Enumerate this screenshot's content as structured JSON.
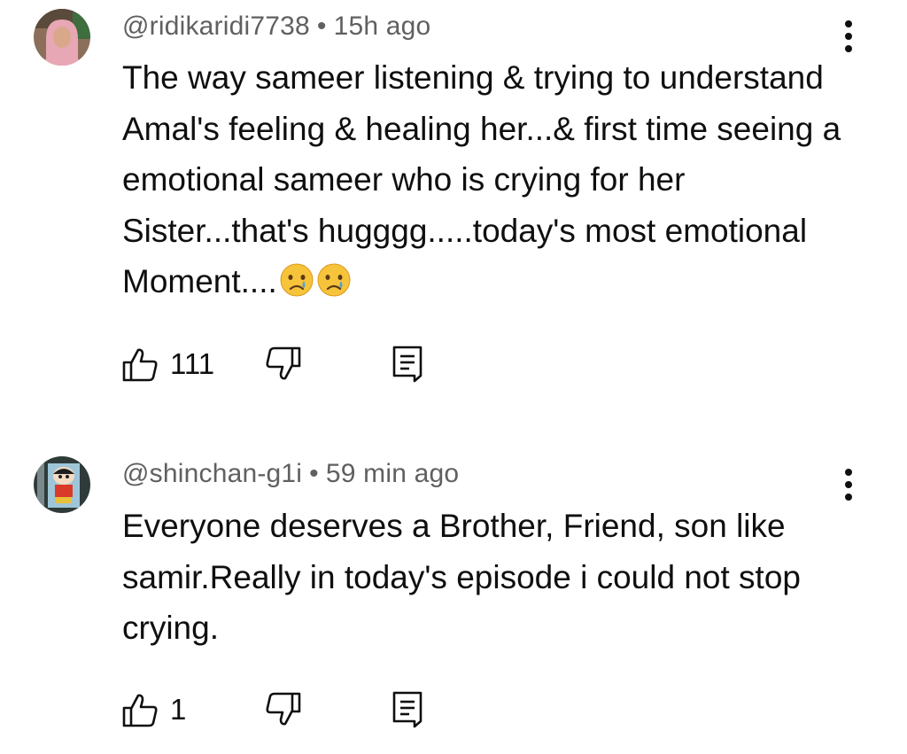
{
  "comments": [
    {
      "handle": "@ridikaridi7738",
      "separator": "•",
      "time": "15h ago",
      "text": "The way sameer listening & trying to understand Amal's feeling & healing her...& first time seeing a emotional sameer who is crying for her Sister...that's hugggg.....today's most emotional Moment....",
      "emojis": [
        "crying-face",
        "crying-face"
      ],
      "like_count": "111",
      "icons": [
        "avatar-photo",
        "thumbs-up-icon",
        "thumbs-down-icon",
        "reply-icon",
        "more-vertical-icon"
      ]
    },
    {
      "handle": "@shinchan-g1i",
      "separator": "•",
      "time": "59 min ago",
      "text": "Everyone deserves a Brother, Friend, son like samir.Really in today's episode i could not stop crying.",
      "like_count": "1",
      "icons": [
        "avatar-cartoon",
        "thumbs-up-icon",
        "thumbs-down-icon",
        "reply-icon",
        "more-vertical-icon"
      ]
    }
  ],
  "colors": {
    "text": "#0f0f0f",
    "meta": "#606060",
    "background": "#ffffff"
  }
}
